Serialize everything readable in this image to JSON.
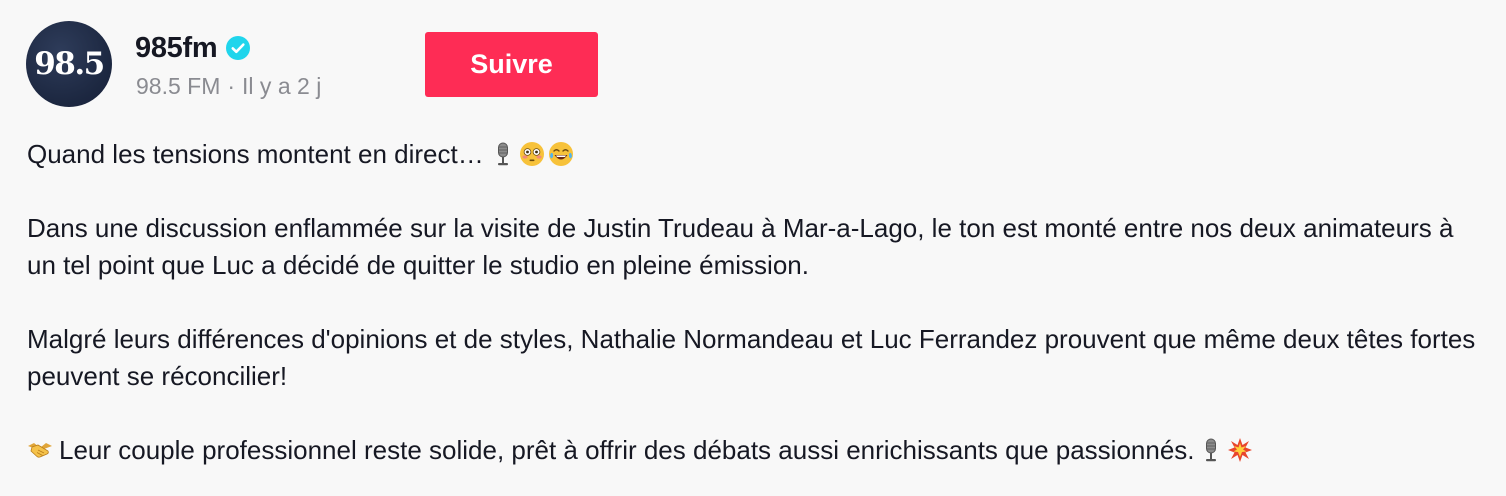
{
  "post": {
    "avatar_text": "98.5",
    "username": "985fm",
    "verified_icon": "verified-check-icon",
    "display_name": "98.5 FM",
    "separator": "·",
    "posted_ago": "Il y a 2 j",
    "follow_label": "Suivre"
  },
  "description": {
    "line1": "Quand les tensions montent en direct…",
    "paragraph2": "Dans une discussion enflammée sur la visite de Justin Trudeau à Mar-a-Lago, le ton est monté entre nos deux animateurs à un tel point que Luc a décidé de quitter le studio en pleine émission.",
    "paragraph3": "Malgré leurs différences d'opinions et de styles, Nathalie Normandeau et Luc Ferrandez prouvent que même deux têtes fortes peuvent se réconcilier!",
    "paragraph4": "Leur couple professionnel reste solide, prêt à offrir des débats aussi enrichissants que passionnés."
  },
  "icons": {
    "microphone": "microphone-emoji-icon",
    "flushed": "flushed-face-emoji-icon",
    "laughing": "tears-of-joy-emoji-icon",
    "handshake": "handshake-emoji-icon",
    "collision": "collision-emoji-icon"
  },
  "colors": {
    "accent": "#fe2c55",
    "verified": "#20d5ec",
    "muted_text": "#8a8b91",
    "avatar_bg": "#1c2740"
  }
}
